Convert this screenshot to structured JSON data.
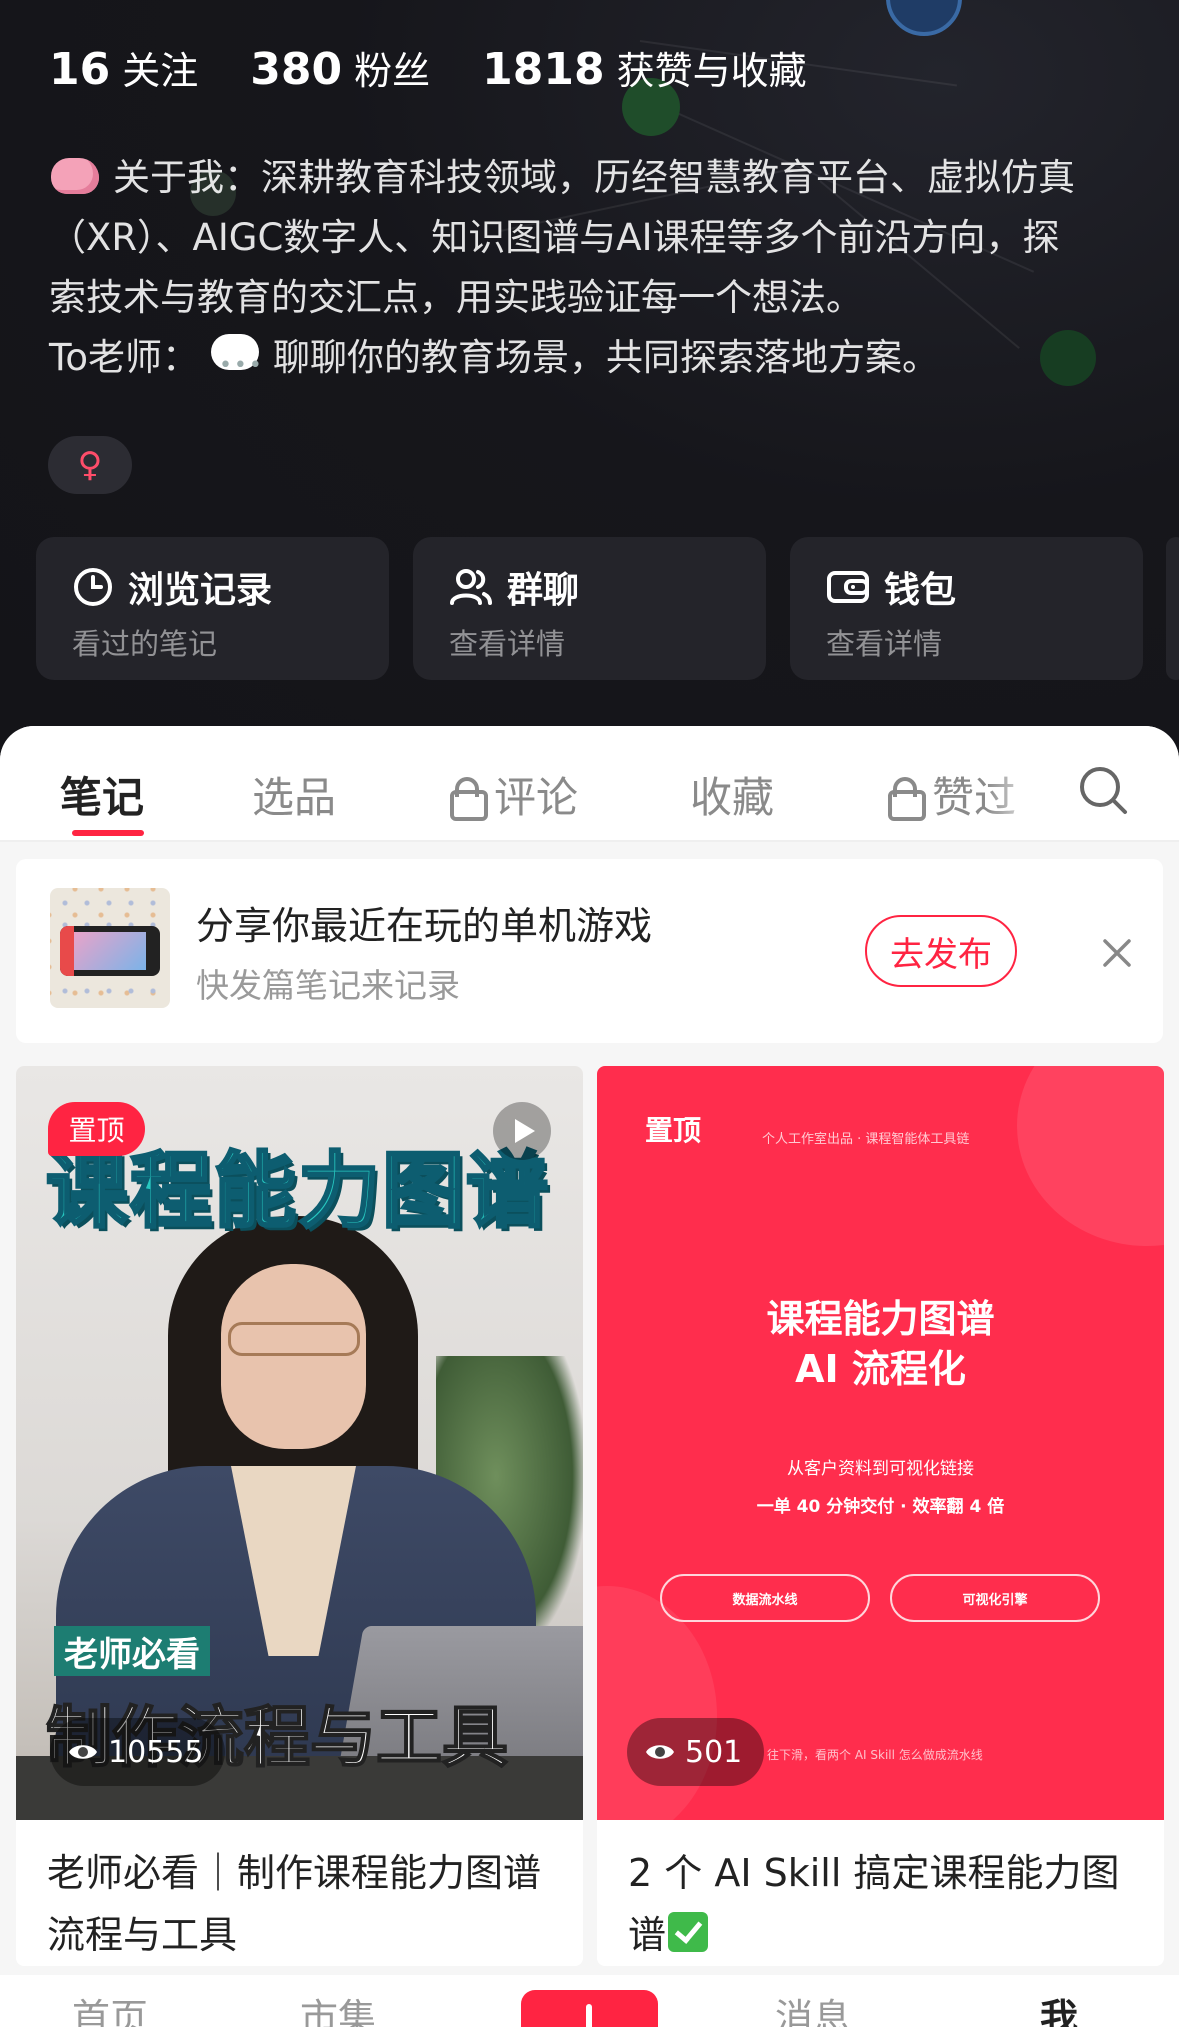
{
  "colors": {
    "accent": "#ff2442",
    "header_bg": "#15151a",
    "card_red": "#ff2d4d"
  },
  "profile": {
    "stats": [
      {
        "num": "16",
        "label": "关注"
      },
      {
        "num": "380",
        "label": "粉丝"
      },
      {
        "num": "1818",
        "label": "获赞与收藏"
      }
    ],
    "bio_lines": [
      "关于我：深耕教育科技领域，历经智慧教育平台、虚拟仿真",
      "（XR）、AIGC数字人、知识图谱与AI课程等多个前沿方向，探",
      "索技术与教育的交汇点，用实践验证每一个想法。",
      "To老师：",
      "聊聊你的教育场景，共同探索落地方案。"
    ],
    "gender_symbol": "♀",
    "quick_actions": [
      {
        "icon": "clock-icon",
        "title": "浏览记录",
        "sub": "看过的笔记"
      },
      {
        "icon": "group-icon",
        "title": "群聊",
        "sub": "查看详情"
      },
      {
        "icon": "wallet-icon",
        "title": "钱包",
        "sub": "查看详情"
      }
    ]
  },
  "tabs": [
    {
      "label": "笔记",
      "active": true,
      "locked": false
    },
    {
      "label": "选品",
      "active": false,
      "locked": false
    },
    {
      "label": "评论",
      "active": false,
      "locked": true
    },
    {
      "label": "收藏",
      "active": false,
      "locked": false
    },
    {
      "label": "赞过",
      "active": false,
      "locked": true
    }
  ],
  "promo": {
    "title": "分享你最近在玩的单机游戏",
    "subtitle": "快发篇笔记来记录",
    "button": "去发布"
  },
  "notes": [
    {
      "pin": "置顶",
      "cover_title": "课程能力图谱",
      "cover_tag": "老师必看",
      "cover_subtitle": "制作流程与工具",
      "views": "10555",
      "caption": "老师必看｜制作课程能力图谱流程与工具"
    },
    {
      "pin": "置顶",
      "cover_top": "个人工作室出品 · 课程智能体工具链",
      "cover_h1": "课程能力图谱",
      "cover_h2": "AI 流程化",
      "cover_p1": "从客户资料到可视化链接",
      "cover_p2": "一单 40 分钟交付 · 效率翻 4 倍",
      "pill1": "数据流水线",
      "pill2": "可视化引擎",
      "cover_foot": "往下滑，看两个 AI Skill 怎么做成流水线",
      "views": "501",
      "caption": "2 个 AI Skill 搞定课程能力图谱"
    }
  ],
  "bottom_nav": {
    "home": "首页",
    "market": "市集",
    "messages": "消息",
    "me": "我"
  }
}
